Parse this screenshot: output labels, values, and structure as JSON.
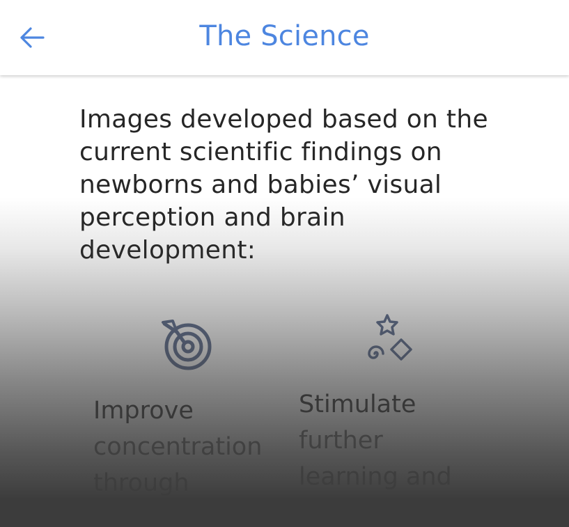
{
  "header": {
    "title": "The Science",
    "back_icon": "arrow-left-icon",
    "accent_color": "#4d86e0"
  },
  "intro": {
    "text": "Images developed based on the current scientific findings on newborns and babies’ visual perception and brain development:"
  },
  "features": [
    {
      "icon": "target-dart-icon",
      "title": "Improve",
      "description": "concentration\nthrough"
    },
    {
      "icon": "shapes-star-spiral-icon",
      "title": "Stimulate",
      "description": "further\nlearning and"
    }
  ]
}
